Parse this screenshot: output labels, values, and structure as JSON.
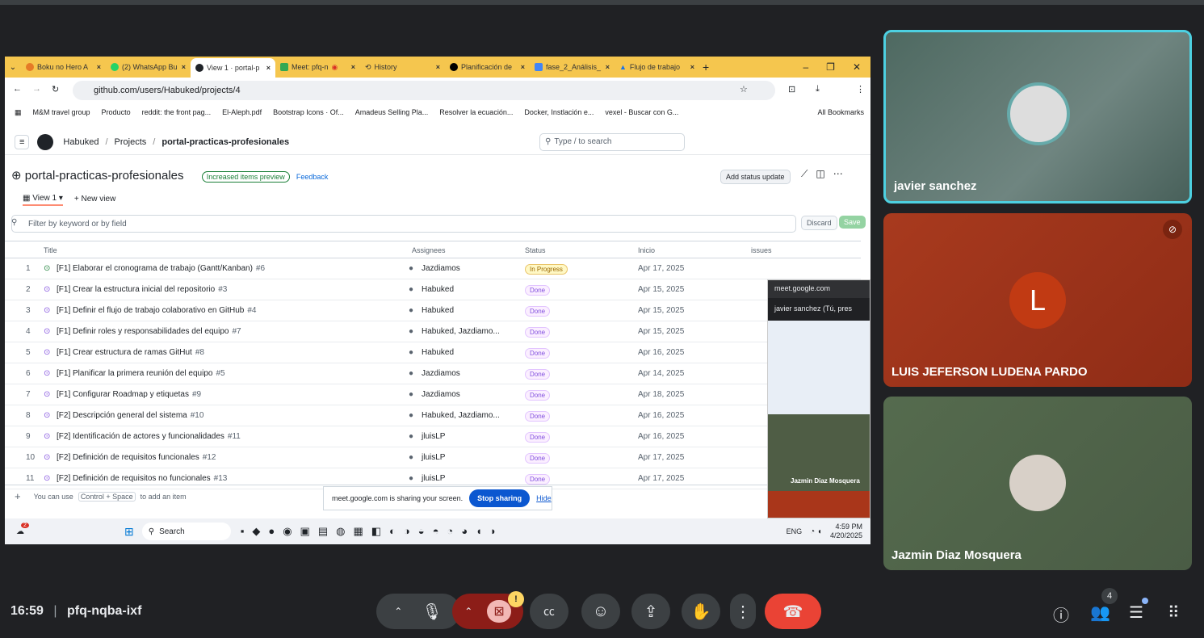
{
  "colors": {
    "meet_bg": "#202124",
    "tabbar": "#f5c64e",
    "stop_sharing": "#0b57d0",
    "end_call": "#ea4335",
    "done_badge": "#8250df",
    "progress_badge": "#9a6700",
    "active_speaker_border": "#4dd0e1"
  },
  "browser": {
    "tabs": [
      {
        "label": "Boku no Hero A",
        "icon": "anime-icon"
      },
      {
        "label": "(2) WhatsApp Bu",
        "icon": "whatsapp-icon"
      },
      {
        "label": "View 1 · portal-p",
        "icon": "github-icon"
      },
      {
        "label": "Meet: pfq-n",
        "icon": "meet-icon"
      },
      {
        "label": "History",
        "icon": "history-icon"
      },
      {
        "label": "Planificación de",
        "icon": "notion-icon"
      },
      {
        "label": "fase_2_Análisis_",
        "icon": "docs-icon"
      },
      {
        "label": "Flujo de trabajo",
        "icon": "drive-icon"
      }
    ],
    "url": "github.com/users/Habuked/projects/4",
    "bookmarks": [
      "M&M travel group",
      "Producto",
      "reddit: the front pag...",
      "El-Aleph.pdf",
      "Bootstrap Icons · Of...",
      "Amadeus Selling Pla...",
      "Resolver la ecuación...",
      "Docker, Instlación e...",
      "vexel - Buscar con G..."
    ],
    "all_bookmarks": "All Bookmarks"
  },
  "github": {
    "breadcrumb": [
      "Habuked",
      "Projects",
      "portal-practicas-profesionales"
    ],
    "search_placeholder": "Type / to search",
    "project_title": "portal-practicas-profesionales",
    "preview_pill": "Increased items preview",
    "feedback": "Feedback",
    "add_status": "Add status update",
    "view_tab": "View 1",
    "new_view": "New view",
    "filter_placeholder": "Filter by keyword or by field",
    "discard": "Discard",
    "save": "Save",
    "columns": [
      "Title",
      "Assignees",
      "Status",
      "Inicio",
      "issues"
    ],
    "rows": [
      {
        "n": "1",
        "title": "[F1] Elaborar el cronograma de trabajo (Gantt/Kanban)",
        "num": "#6",
        "assignee": "Jazdiamos",
        "status": "In Progress",
        "date": "Apr 17, 2025"
      },
      {
        "n": "2",
        "title": "[F1] Crear la estructura inicial del repositorio",
        "num": "#3",
        "assignee": "Habuked",
        "status": "Done",
        "date": "Apr 15, 2025"
      },
      {
        "n": "3",
        "title": "[F1] Definir el flujo de trabajo colaborativo en GitHub",
        "num": "#4",
        "assignee": "Habuked",
        "status": "Done",
        "date": "Apr 15, 2025"
      },
      {
        "n": "4",
        "title": "[F1] Definir roles y responsabilidades del equipo",
        "num": "#7",
        "assignee": "Habuked, Jazdiamo...",
        "status": "Done",
        "date": "Apr 15, 2025"
      },
      {
        "n": "5",
        "title": "[F1] Crear estructura de ramas GitHut",
        "num": "#8",
        "assignee": "Habuked",
        "status": "Done",
        "date": "Apr 16, 2025"
      },
      {
        "n": "6",
        "title": "[F1] Planificar la primera reunión del equipo",
        "num": "#5",
        "assignee": "Jazdiamos",
        "status": "Done",
        "date": "Apr 14, 2025"
      },
      {
        "n": "7",
        "title": "[F1] Configurar Roadmap y etiquetas",
        "num": "#9",
        "assignee": "Jazdiamos",
        "status": "Done",
        "date": "Apr 18, 2025"
      },
      {
        "n": "8",
        "title": "[F2] Descripción general del sistema",
        "num": "#10",
        "assignee": "Habuked, Jazdiamo...",
        "status": "Done",
        "date": "Apr 16, 2025"
      },
      {
        "n": "9",
        "title": "[F2] Identificación de actores y funcionalidades",
        "num": "#11",
        "assignee": "jluisLP",
        "status": "Done",
        "date": "Apr 16, 2025"
      },
      {
        "n": "10",
        "title": "[F2] Definición de requisitos funcionales",
        "num": "#12",
        "assignee": "jluisLP",
        "status": "Done",
        "date": "Apr 17, 2025"
      },
      {
        "n": "11",
        "title": "[F2] Definición de requisitos no funcionales",
        "num": "#13",
        "assignee": "jluisLP",
        "status": "Done",
        "date": "Apr 17, 2025"
      }
    ],
    "add_item_hint": "You can use",
    "add_item_kbd": "Control + Space",
    "add_item_hint2": "to add an item"
  },
  "share_bar": {
    "text": "meet.google.com is sharing your screen.",
    "stop": "Stop sharing",
    "hide": "Hide"
  },
  "mini_meet": {
    "url": "meet.google.com",
    "presenter": "javier sanchez (Tú, pres",
    "tile_name": "Jazmin Diaz Mosquera"
  },
  "taskbar": {
    "search": "Search",
    "lang": "ENG",
    "time": "4:59 PM",
    "date": "4/20/2025",
    "badge": "2"
  },
  "participants": [
    {
      "name": "javier sanchez",
      "initial": ""
    },
    {
      "name": "LUIS JEFERSON LUDENA PARDO",
      "initial": "L"
    },
    {
      "name": "Jazmin Diaz Mosquera",
      "initial": ""
    }
  ],
  "meeting": {
    "time": "16:59",
    "code": "pfq-nqba-ixf",
    "people_count": "4",
    "camera_alert": "!"
  }
}
